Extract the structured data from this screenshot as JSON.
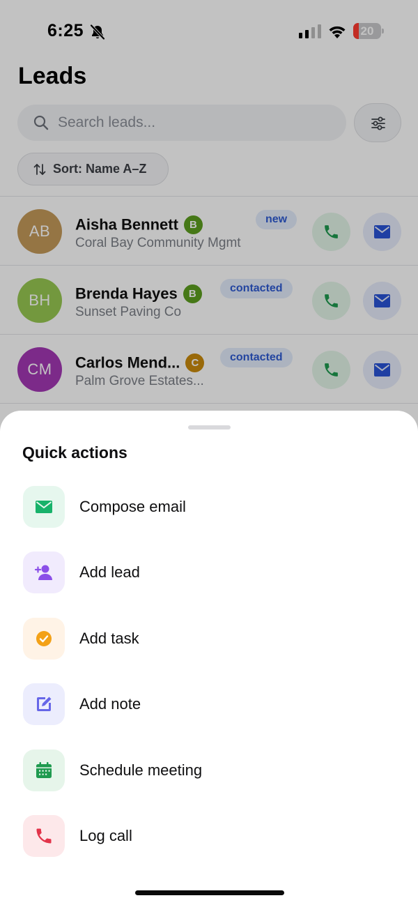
{
  "status_bar": {
    "time": "6:25",
    "battery_level": "20"
  },
  "header": {
    "title": "Leads"
  },
  "search": {
    "placeholder": "Search leads..."
  },
  "sort": {
    "label": "Sort: Name A–Z"
  },
  "leads": [
    {
      "initials": "AB",
      "avatar_color": "#c49a5a",
      "name": "Aisha Bennett",
      "grade": "B",
      "grade_color": "#5c9e1f",
      "company": "Coral Bay Community Mgmt",
      "status": "new"
    },
    {
      "initials": "BH",
      "avatar_color": "#97c852",
      "name": "Brenda Hayes",
      "grade": "B",
      "grade_color": "#5c9e1f",
      "company": "Sunset Paving Co",
      "status": "contacted"
    },
    {
      "initials": "CM",
      "avatar_color": "#a338b5",
      "name": "Carlos Mend...",
      "grade": "C",
      "grade_color": "#c98a0c",
      "company": "Palm Grove Estates...",
      "status": "contacted"
    }
  ],
  "sheet": {
    "title": "Quick actions",
    "actions": [
      {
        "label": "Compose email",
        "icon": "mail-icon",
        "bg": "#e6f7ee",
        "color": "#17b26a"
      },
      {
        "label": "Add lead",
        "icon": "add-person-icon",
        "bg": "#f1ebfd",
        "color": "#8b4fe8"
      },
      {
        "label": "Add task",
        "icon": "check-circle-icon",
        "bg": "#fff3e6",
        "color": "#f3a117"
      },
      {
        "label": "Add note",
        "icon": "edit-note-icon",
        "bg": "#ecedfd",
        "color": "#6666e8"
      },
      {
        "label": "Schedule meeting",
        "icon": "calendar-icon",
        "bg": "#e6f5ea",
        "color": "#1f9a4f"
      },
      {
        "label": "Log call",
        "icon": "phone-icon",
        "bg": "#fde8ea",
        "color": "#e2344a"
      }
    ]
  }
}
